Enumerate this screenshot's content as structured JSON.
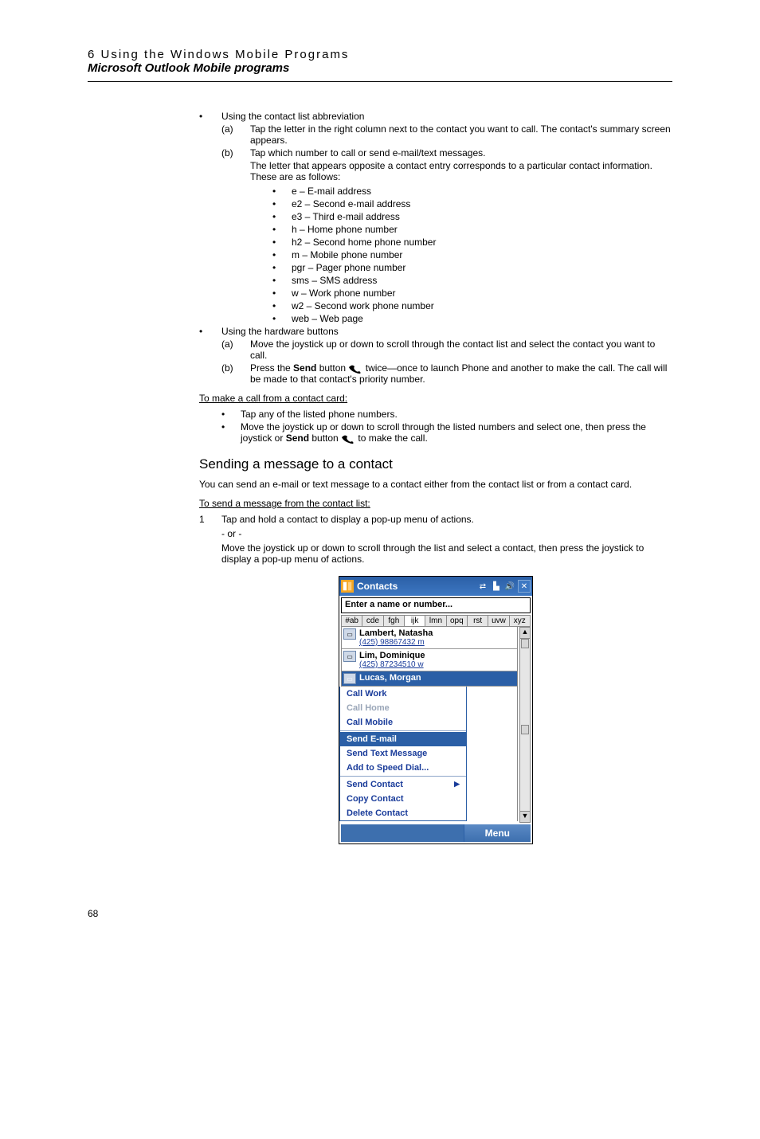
{
  "header": {
    "chapter": "6 Using the Windows Mobile Programs",
    "section": "Microsoft Outlook Mobile programs"
  },
  "b1": {
    "t": "Using the contact list abbreviation",
    "a": {
      "lbl": "(a)",
      "txt": "Tap the letter in the right column next to the contact you want to call. The contact's summary screen appears."
    },
    "b": {
      "lbl": "(b)",
      "txt": "Tap which number to call or send e-mail/text messages."
    },
    "b_after": "The letter that appears opposite a contact entry corresponds to a particular contact information. These are as follows:",
    "codes": {
      "e": "e – E-mail address",
      "e2": "e2 – Second e-mail address",
      "e3": "e3 – Third e-mail address",
      "h": "h – Home phone number",
      "h2": "h2 – Second home phone number",
      "m": "m – Mobile phone number",
      "pgr": "pgr – Pager phone number",
      "sms": "sms – SMS address",
      "w": "w – Work phone number",
      "w2": "w2 – Second work phone number",
      "web": "web – Web page"
    }
  },
  "b2": {
    "t": "Using the hardware buttons",
    "a": {
      "lbl": "(a)",
      "txt": "Move the joystick up or down to scroll through the contact list and select the contact you want to call."
    },
    "b": {
      "lbl": "(b)",
      "pre": "Press the ",
      "bold": "Send",
      "post1": " button ",
      "post2": " twice—once to launch Phone and another to make the call. The call will be made to that contact's priority number."
    }
  },
  "u1": "To make a call from a contact card:",
  "u1_b1": "Tap any of the listed phone numbers.",
  "u1_b2": {
    "pre": "Move the joystick up or down to scroll through the listed numbers and select one, then press the joystick or ",
    "bold": "Send",
    "post1": " button ",
    "post2": " to make the call."
  },
  "h3": "Sending a message to a contact",
  "p1": "You can send an e-mail or text message to a contact either from the contact list or from a contact card.",
  "u2": "To send a message from the contact list: ",
  "s1": {
    "n": "1",
    "txt": "Tap and hold a contact to display a pop-up menu of actions."
  },
  "or": "- or -",
  "s1_after": "Move the joystick up or down to scroll through the list and select a contact, then press the joystick to display a pop-up menu of actions.",
  "screenshot": {
    "title": "Contacts",
    "input_placeholder": "Enter a name or number...",
    "tabs": [
      "#ab",
      "cde",
      "fgh",
      "ijk",
      "lmn",
      "opq",
      "rst",
      "uvw",
      "xyz"
    ],
    "rows": [
      {
        "name": "Lambert, Natasha",
        "num": "(425) 98867432   m"
      },
      {
        "name": "Lim, Dominique",
        "num": "(425) 87234510   w"
      },
      {
        "name": "Lucas, Morgan",
        "num": "",
        "selected": true
      }
    ],
    "menu": {
      "items": [
        {
          "label": "Call Work",
          "state": "normal"
        },
        {
          "label": "Call Home",
          "state": "disabled"
        },
        {
          "label": "Call Mobile",
          "state": "normal"
        },
        {
          "label": "Send E-mail",
          "state": "selected"
        },
        {
          "label": "Send Text Message",
          "state": "normal"
        },
        {
          "label": "Add to Speed Dial...",
          "state": "normal"
        },
        {
          "label": "Send Contact",
          "state": "normal",
          "arrow": true
        },
        {
          "label": "Copy Contact",
          "state": "normal"
        },
        {
          "label": "Delete Contact",
          "state": "normal"
        }
      ]
    },
    "softkey_right": "Menu"
  },
  "page_number": "68"
}
